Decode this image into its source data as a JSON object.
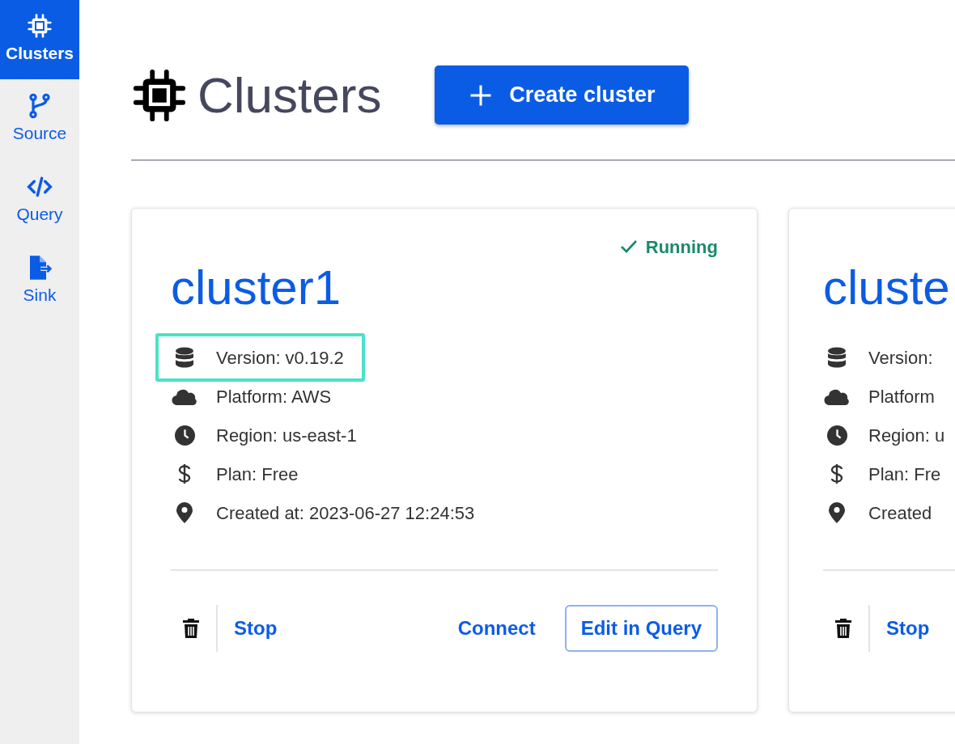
{
  "sidebar": {
    "items": [
      {
        "label": "Clusters",
        "selected": true
      },
      {
        "label": "Source",
        "selected": false
      },
      {
        "label": "Query",
        "selected": false
      },
      {
        "label": "Sink",
        "selected": false
      }
    ]
  },
  "header": {
    "title": "Clusters",
    "create_button": "Create cluster"
  },
  "clusters": [
    {
      "name": "cluster1",
      "status": "Running",
      "details": [
        {
          "text": "Version: v0.19.2",
          "highlighted": true
        },
        {
          "text": "Platform: AWS",
          "highlighted": false
        },
        {
          "text": "Region: us-east-1",
          "highlighted": false
        },
        {
          "text": "Plan: Free",
          "highlighted": false
        },
        {
          "text": "Created at: 2023-06-27 12:24:53",
          "highlighted": false
        }
      ],
      "actions": {
        "stop": "Stop",
        "connect": "Connect",
        "edit": "Edit in Query"
      }
    },
    {
      "name": "cluste",
      "details": [
        {
          "text": "Version:",
          "highlighted": false
        },
        {
          "text": "Platform",
          "highlighted": false
        },
        {
          "text": "Region: u",
          "highlighted": false
        },
        {
          "text": "Plan: Fre",
          "highlighted": false
        },
        {
          "text": "Created",
          "highlighted": false
        }
      ],
      "actions": {
        "stop": "Stop"
      }
    }
  ]
}
